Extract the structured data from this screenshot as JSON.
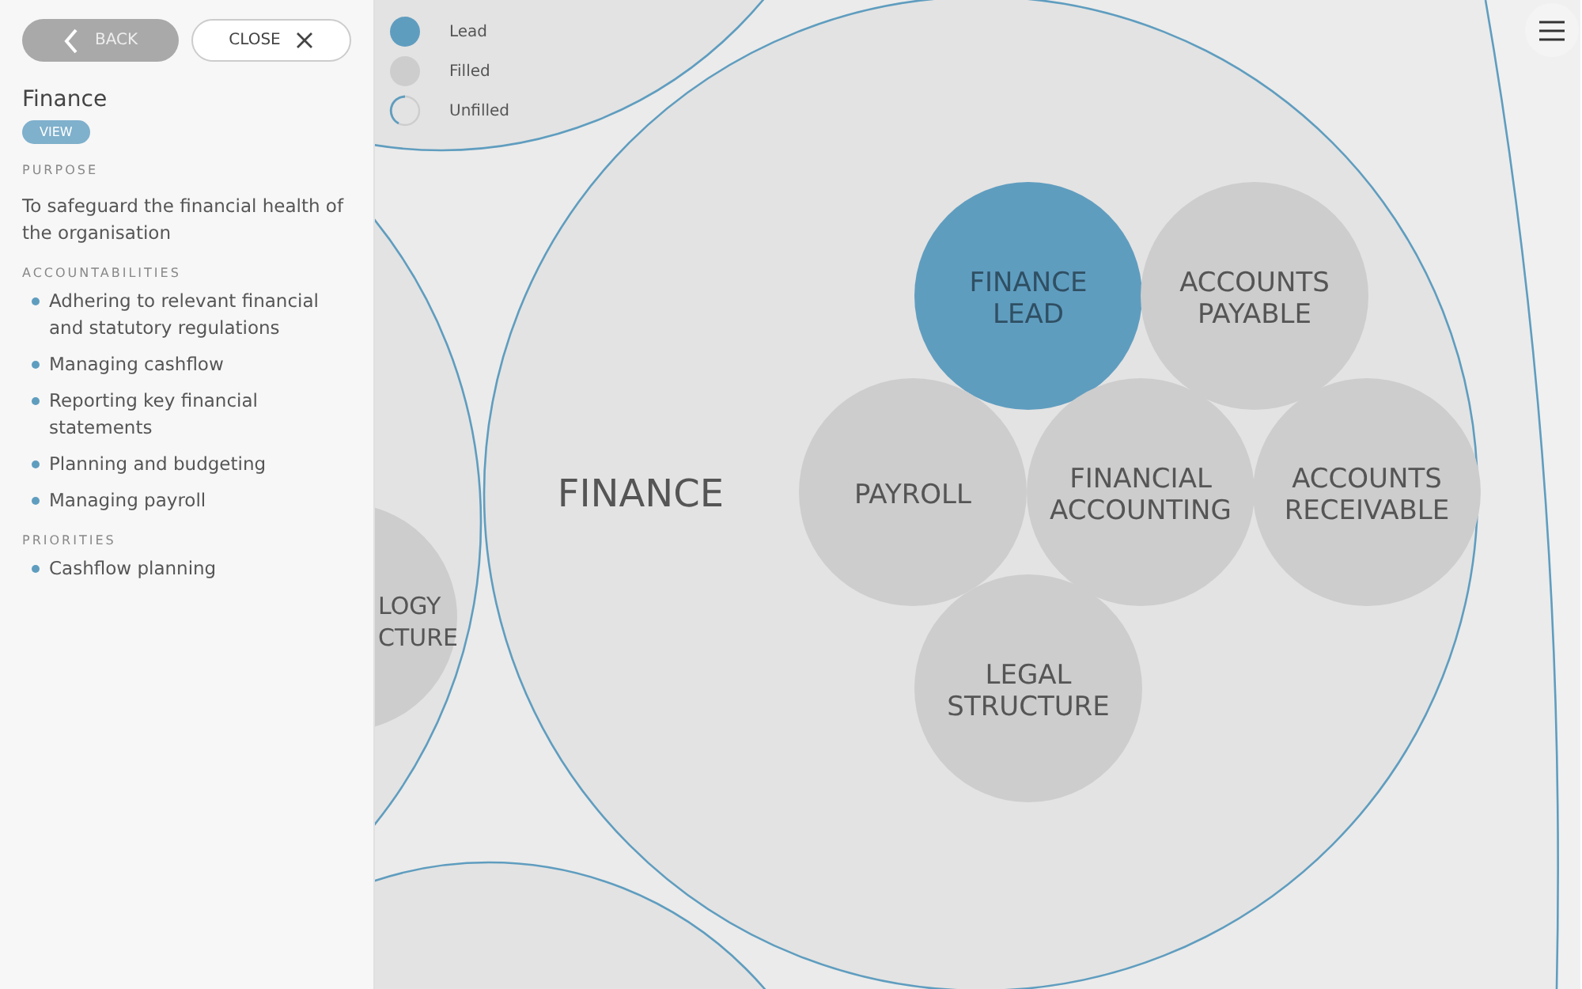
{
  "sidebar": {
    "back_button": "BACK",
    "close_button": "CLOSE",
    "title": "Finance",
    "view_button": "VIEW",
    "sections": [
      {
        "heading": "PURPOSE",
        "kind": "paragraph",
        "text": "To safeguard the financial health of the organisation"
      },
      {
        "heading": "ACCOUNTABILITIES",
        "kind": "list",
        "items": [
          "Adhering to relevant financial and statutory regulations",
          "Managing cashflow",
          "Reporting key financial statements",
          "Planning and budgeting",
          "Managing payroll"
        ]
      },
      {
        "heading": "PRIORITIES",
        "kind": "list",
        "items": [
          "Cashflow planning"
        ]
      }
    ]
  },
  "legend": [
    {
      "kind": "lead",
      "label": "Lead"
    },
    {
      "kind": "filled",
      "label": "Filled"
    },
    {
      "kind": "unfilled",
      "label": "Unfilled"
    }
  ],
  "map": {
    "circle_label": "FINANCE",
    "neighbour_label": [
      "LOGY",
      "CTURE"
    ],
    "roles": [
      {
        "kind": "lead",
        "lines": [
          "FINANCE",
          "LEAD"
        ]
      },
      {
        "kind": "filled",
        "lines": [
          "ACCOUNTS",
          "PAYABLE"
        ]
      },
      {
        "kind": "filled",
        "lines": [
          "PAYROLL"
        ]
      },
      {
        "kind": "filled",
        "lines": [
          "FINANCIAL",
          "ACCOUNTING"
        ]
      },
      {
        "kind": "filled",
        "lines": [
          "ACCOUNTS",
          "RECEIVABLE"
        ]
      },
      {
        "kind": "filled",
        "lines": [
          "LEGAL",
          "STRUCTURE"
        ]
      }
    ]
  }
}
